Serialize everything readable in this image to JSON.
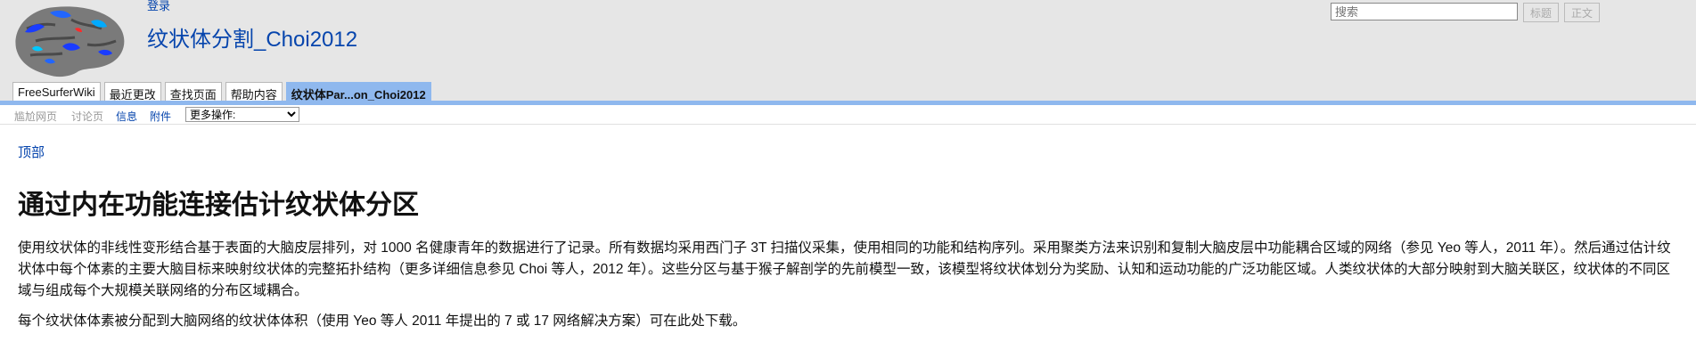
{
  "header": {
    "login_label": "登录",
    "page_title": "纹状体分割_Choi2012",
    "search_placeholder": "搜索",
    "title_button": "标题",
    "text_button": "正文"
  },
  "tabs": [
    {
      "label": "FreeSurferWiki"
    },
    {
      "label": "最近更改"
    },
    {
      "label": "查找页面"
    },
    {
      "label": "帮助内容"
    },
    {
      "label": "纹状体Par...on_Choi2012"
    }
  ],
  "page_actions": {
    "immutable_page": "尴尬网页",
    "discussion": "讨论页",
    "info": "信息",
    "attachments": "附件",
    "more_actions_selected": "更多操作:"
  },
  "content": {
    "top_link": "顶部",
    "heading": "通过内在功能连接估计纹状体分区",
    "paragraph1": "使用纹状体的非线性变形结合基于表面的大脑皮层排列，对 1000 名健康青年的数据进行了记录。所有数据均采用西门子 3T 扫描仪采集，使用相同的功能和结构序列。采用聚类方法来识别和复制大脑皮层中功能耦合区域的网络（参见 Yeo 等人，2011 年）。然后通过估计纹状体中每个体素的主要大脑目标来映射纹状体的完整拓扑结构（更多详细信息参见 Choi 等人，2012 年）。这些分区与基于猴子解剖学的先前模型一致，该模型将纹状体划分为奖励、认知和运动功能的广泛功能区域。人类纹状体的大部分映射到大脑关联区，纹状体的不同区域与组成每个大规模关联网络的分布区域耦合。",
    "paragraph2": "每个纹状体体素被分配到大脑网络的纹状体体积（使用 Yeo 等人 2011 年提出的 7 或 17 网络解决方案）可在此处下载。"
  },
  "colors": {
    "link": "#0645ad",
    "tab_active": "#8fb8ee",
    "header_bg": "#e6e6e6"
  }
}
